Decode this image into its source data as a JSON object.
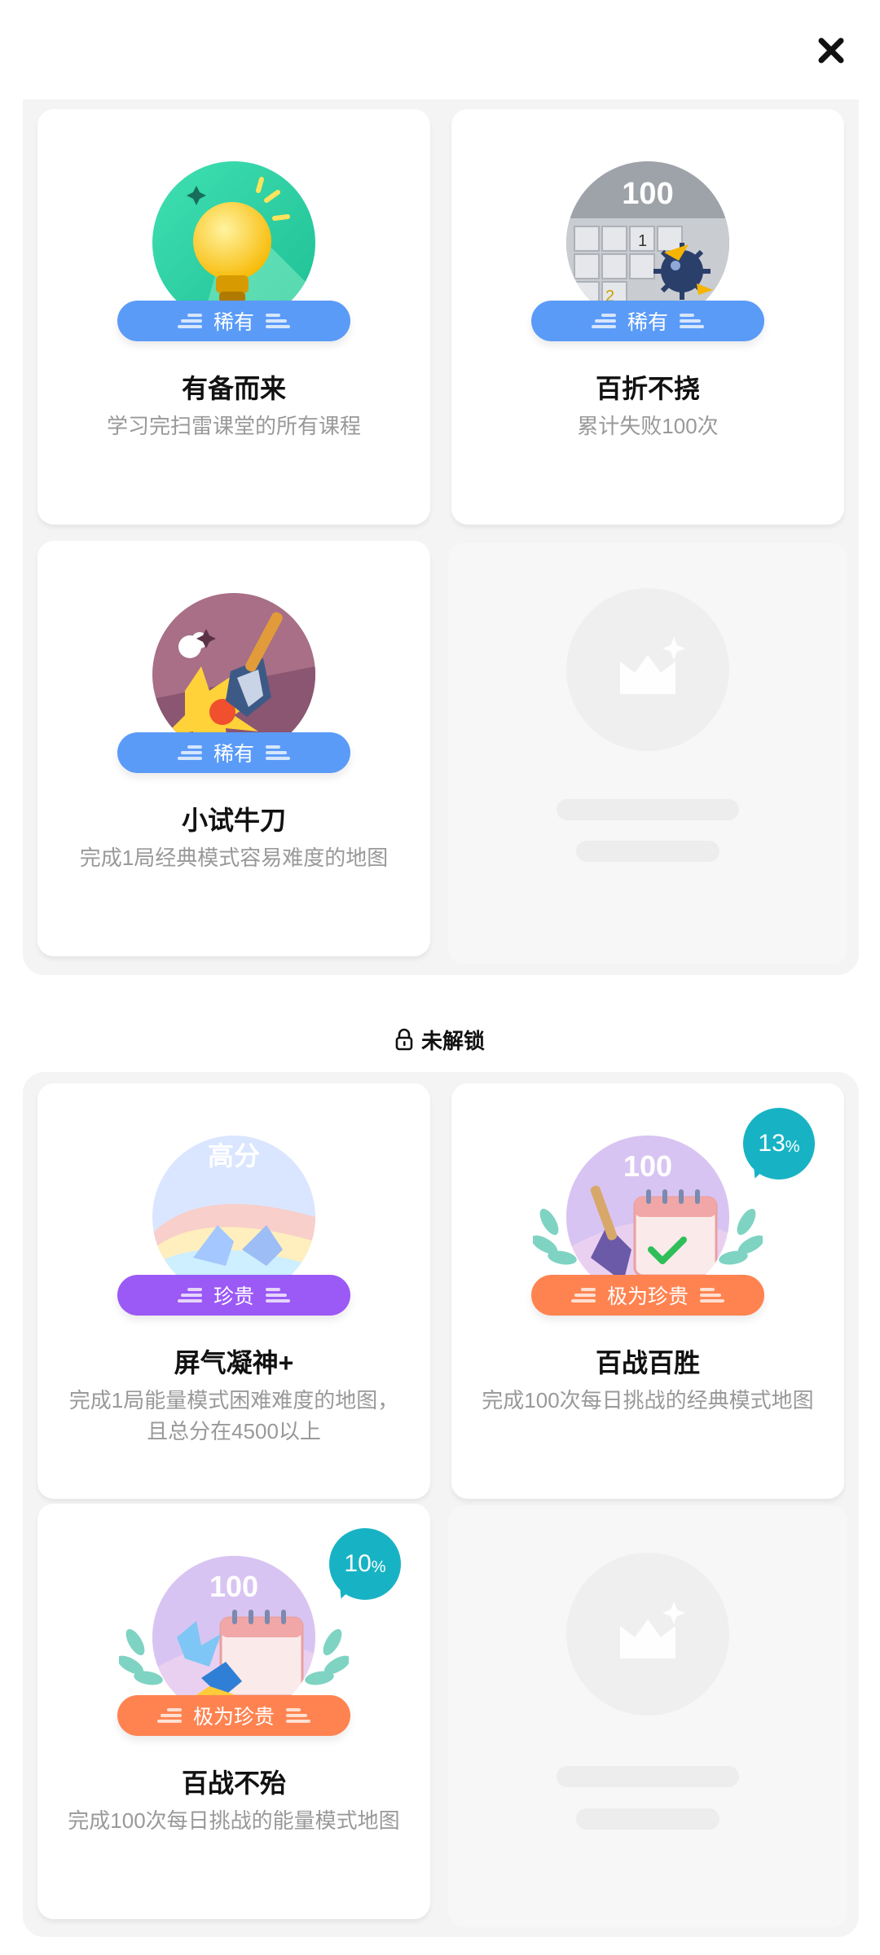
{
  "header": {
    "close_label": "×"
  },
  "unlocked": {
    "cards": [
      {
        "title": "有备而来",
        "desc": "学习完扫雷课堂的所有课程",
        "rarity": "稀有",
        "rarity_color": "#5b9bf8"
      },
      {
        "title": "百折不挠",
        "desc": "累计失败100次",
        "rarity": "稀有",
        "rarity_color": "#5b9bf8",
        "art_text": "100"
      },
      {
        "title": "小试牛刀",
        "desc": "完成1局经典模式容易难度的地图",
        "rarity": "稀有",
        "rarity_color": "#5b9bf8"
      }
    ]
  },
  "locked_section": {
    "label": "未解锁"
  },
  "locked": {
    "cards": [
      {
        "title": "屏气凝神+",
        "desc": "完成1局能量模式困难难度的地图，且总分在4500以上",
        "rarity": "珍贵",
        "rarity_color": "#9b59f6",
        "art_text": "高分"
      },
      {
        "title": "百战百胜",
        "desc": "完成100次每日挑战的经典模式地图",
        "rarity": "极为珍贵",
        "rarity_color": "#ff8350",
        "art_text": "100",
        "progress_num": "13",
        "progress_unit": "%"
      },
      {
        "title": "百战不殆",
        "desc": "完成100次每日挑战的能量模式地图",
        "rarity": "极为珍贵",
        "rarity_color": "#ff8350",
        "art_text": "100",
        "progress_num": "10",
        "progress_unit": "%"
      }
    ]
  }
}
